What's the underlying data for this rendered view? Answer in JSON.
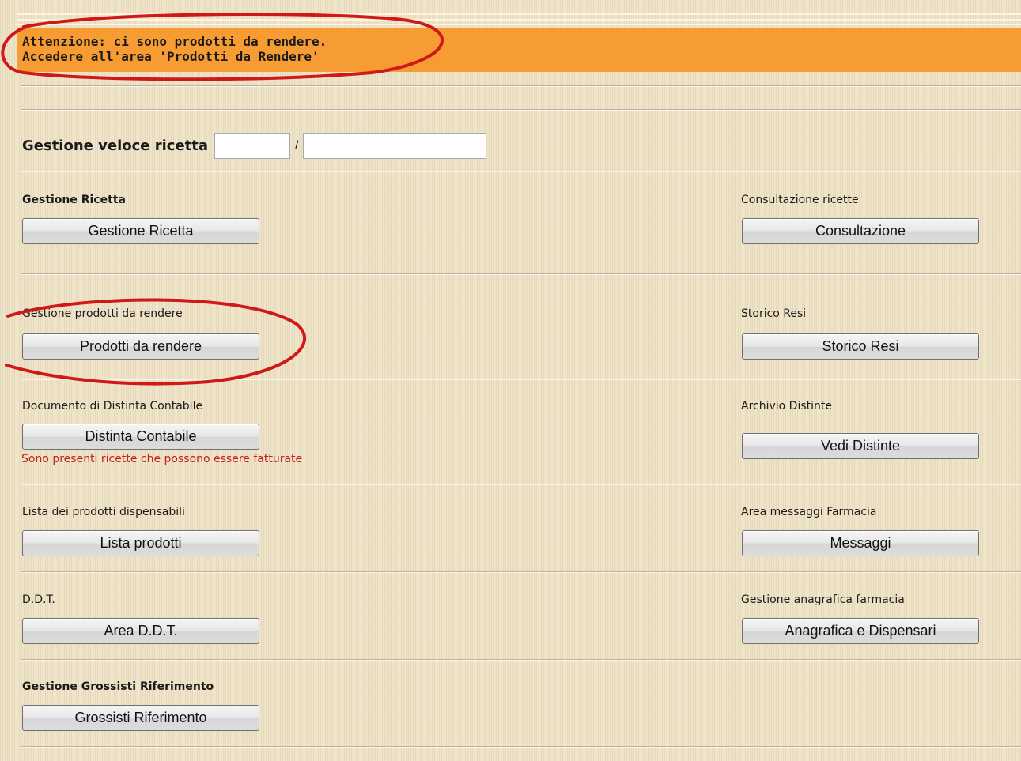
{
  "banner": {
    "line1": "Attenzione: ci sono prodotti da rendere.",
    "line2": "Accedere all'area 'Prodotti da Rendere'",
    "color": "#f79b33"
  },
  "quick": {
    "label": "Gestione veloce ricetta",
    "separator": "/",
    "input1_value": "",
    "input2_value": ""
  },
  "sections": {
    "gestione_ricetta": {
      "label": "Gestione Ricetta",
      "button": "Gestione Ricetta"
    },
    "consultazione": {
      "label": "Consultazione ricette",
      "button": "Consultazione"
    },
    "prodotti_rendere": {
      "label": "Gestione prodotti da rendere",
      "button": "Prodotti da rendere"
    },
    "storico_resi": {
      "label": "Storico Resi",
      "button": "Storico Resi"
    },
    "distinta": {
      "label": "Documento di Distinta Contabile",
      "button": "Distinta Contabile",
      "note": "Sono presenti ricette che possono essere fatturate"
    },
    "archivio": {
      "label": "Archivio Distinte",
      "button": "Vedi Distinte"
    },
    "lista": {
      "label": "Lista dei prodotti dispensabili",
      "button": "Lista prodotti"
    },
    "messaggi": {
      "label": "Area messaggi Farmacia",
      "button": "Messaggi"
    },
    "ddt": {
      "label": "D.D.T.",
      "button": "Area D.D.T."
    },
    "anagrafica": {
      "label": "Gestione anagrafica farmacia",
      "button": "Anagrafica e Dispensari"
    },
    "grossisti": {
      "label": "Gestione Grossisti Riferimento",
      "button": "Grossisti Riferimento"
    }
  },
  "colors": {
    "background": "#efe3c8",
    "warning_text": "#c0221a",
    "callout": "#d01818"
  }
}
